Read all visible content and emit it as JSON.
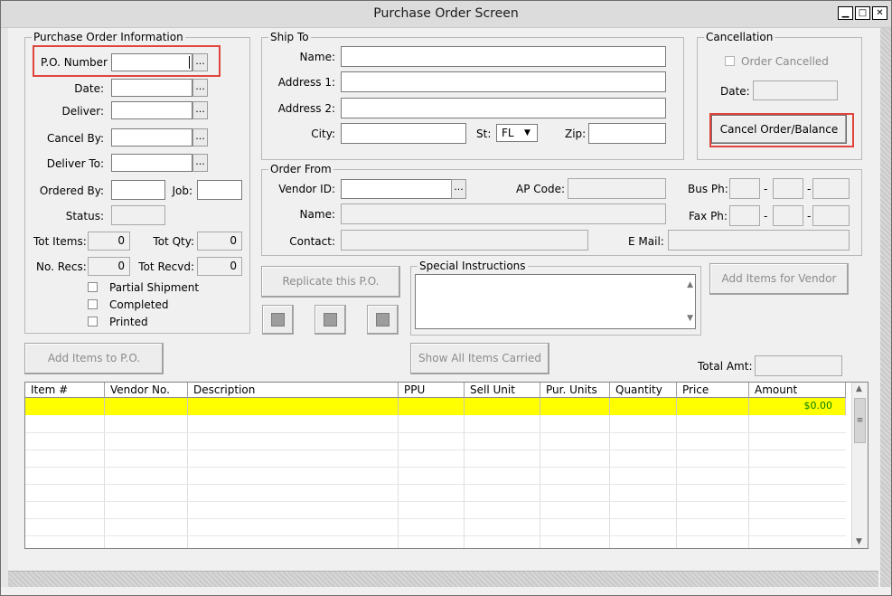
{
  "window": {
    "title": "Purchase Order Screen",
    "min_icon": "minimize-icon",
    "max_icon": "maximize-icon",
    "close_icon": "close-icon"
  },
  "po_info": {
    "group_title": "Purchase Order Information",
    "po_number_label": "P.O. Number",
    "date_label": "Date:",
    "deliver_label": "Deliver:",
    "cancel_by_label": "Cancel By:",
    "deliver_to_label": "Deliver To:",
    "ordered_by_label": "Ordered By:",
    "job_label": "Job:",
    "status_label": "Status:",
    "tot_items_label": "Tot Items:",
    "tot_items_value": "0",
    "tot_qty_label": "Tot Qty:",
    "tot_qty_value": "0",
    "no_recs_label": "No. Recs:",
    "no_recs_value": "0",
    "tot_recvd_label": "Tot Recvd:",
    "tot_recvd_value": "0",
    "partial_shipment_label": "Partial Shipment",
    "completed_label": "Completed",
    "printed_label": "Printed",
    "ellipsis": "..."
  },
  "ship_to": {
    "group_title": "Ship To",
    "name_label": "Name:",
    "address1_label": "Address 1:",
    "address2_label": "Address 2:",
    "city_label": "City:",
    "st_label": "St:",
    "st_value": "FL",
    "zip_label": "Zip:"
  },
  "cancellation": {
    "group_title": "Cancellation",
    "order_cancelled_label": "Order Cancelled",
    "date_label": "Date:",
    "cancel_button": "Cancel Order/Balance"
  },
  "order_from": {
    "group_title": "Order From",
    "vendor_id_label": "Vendor ID:",
    "ap_code_label": "AP Code:",
    "bus_ph_label": "Bus Ph:",
    "name_label": "Name:",
    "fax_ph_label": "Fax Ph:",
    "contact_label": "Contact:",
    "email_label": "E Mail:",
    "dash": "-"
  },
  "actions": {
    "replicate_button": "Replicate this P.O.",
    "add_items_vendor_button": "Add Items for Vendor",
    "add_items_po_button": "Add Items to P.O.",
    "show_all_items_button": "Show All Items Carried",
    "total_amt_label": "Total Amt:",
    "icons": [
      "notes-icon",
      "document-search-icon",
      "checklist-icon"
    ]
  },
  "special_instructions": {
    "group_title": "Special Instructions"
  },
  "grid": {
    "columns": [
      "Item #",
      "Vendor No.",
      "Description",
      "PPU",
      "Sell Unit",
      "Pur. Units",
      "Quantity",
      "Price",
      "Amount"
    ],
    "rows": [
      {
        "amount": "$0.00"
      }
    ]
  },
  "colors": {
    "highlight_row": "#ffff00",
    "amount_text": "#008000",
    "annotation_red": "#e0453d"
  }
}
